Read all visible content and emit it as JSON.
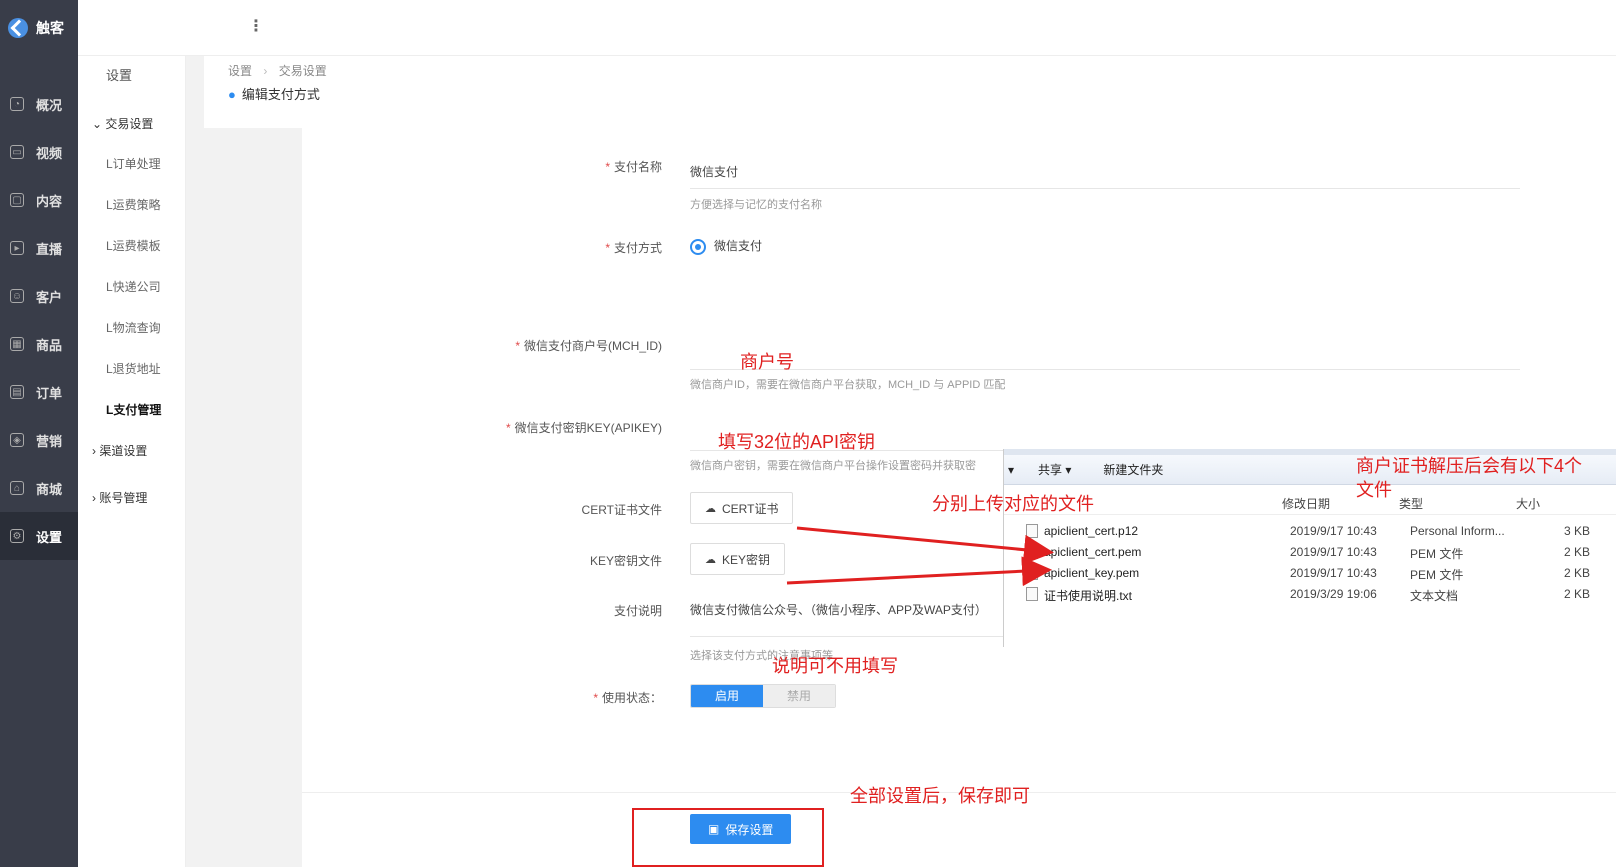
{
  "app": {
    "name": "触客"
  },
  "sidebar": {
    "items": [
      {
        "label": "概况",
        "icon": "dashboard-icon"
      },
      {
        "label": "视频",
        "icon": "video-icon"
      },
      {
        "label": "内容",
        "icon": "content-icon"
      },
      {
        "label": "直播",
        "icon": "live-icon"
      },
      {
        "label": "客户",
        "icon": "customer-icon"
      },
      {
        "label": "商品",
        "icon": "goods-icon"
      },
      {
        "label": "订单",
        "icon": "order-icon"
      },
      {
        "label": "营销",
        "icon": "marketing-icon"
      },
      {
        "label": "商城",
        "icon": "mall-icon"
      },
      {
        "label": "设置",
        "icon": "settings-icon"
      }
    ]
  },
  "subnav": {
    "title": "设置",
    "group_trade": "交易设置",
    "items": [
      "L订单处理",
      "L运费策略",
      "L运费模板",
      "L快递公司",
      "L物流查询",
      "L退货地址",
      "L支付管理"
    ],
    "group_channel": "渠道设置",
    "group_account": "账号管理"
  },
  "breadcrumb": {
    "root": "设置",
    "sep": "›",
    "current": "交易设置",
    "title": "编辑支付方式"
  },
  "form": {
    "pay_name_label": "支付名称",
    "pay_name_value": "微信支付",
    "pay_name_hint": "方便选择与记忆的支付名称",
    "pay_method_label": "支付方式",
    "pay_method_option": "微信支付",
    "mch_id_label": "微信支付商户号(MCH_ID)",
    "mch_id_hint": "微信商户ID，需要在微信商户平台获取，MCH_ID 与 APPID 匹配",
    "apikey_label": "微信支付密钥KEY(APIKEY)",
    "apikey_hint": "微信商户密钥，需要在微信商户平台操作设置密码并获取密",
    "cert_label": "CERT证书文件",
    "cert_button": "CERT证书",
    "key_label": "KEY密钥文件",
    "key_button": "KEY密钥",
    "desc_label": "支付说明",
    "desc_value": "微信支付微信公众号、（微信小程序、APP及WAP支付）",
    "desc_hint": "选择该支付方式的注意事项等",
    "status_label": "使用状态：",
    "status_on": "启用",
    "status_off": "禁用",
    "save_button": "保存设置"
  },
  "annotations": {
    "mch": "商户号",
    "apikey": "填写32位的API密钥",
    "upload": "分别上传对应的文件",
    "files": "商户证书解压后会有以下4个",
    "files2": "文件",
    "desc": "说明可不用填写",
    "save": "全部设置后，保存即可"
  },
  "explorer": {
    "toolbar": {
      "share": "共享 ▾",
      "new_folder": "新建文件夹"
    },
    "columns": {
      "date": "修改日期",
      "type": "类型",
      "size": "大小"
    },
    "files": [
      {
        "name": "apiclient_cert.p12",
        "date": "2019/9/17 10:43",
        "type": "Personal Inform...",
        "size": "3 KB"
      },
      {
        "name": "apiclient_cert.pem",
        "date": "2019/9/17 10:43",
        "type": "PEM 文件",
        "size": "2 KB"
      },
      {
        "name": "apiclient_key.pem",
        "date": "2019/9/17 10:43",
        "type": "PEM 文件",
        "size": "2 KB"
      },
      {
        "name": "证书使用说明.txt",
        "date": "2019/3/29 19:06",
        "type": "文本文档",
        "size": "2 KB"
      }
    ]
  },
  "colors": {
    "primary": "#2d8cf0",
    "sidebar": "#393d49",
    "annotation": "#e02020"
  }
}
